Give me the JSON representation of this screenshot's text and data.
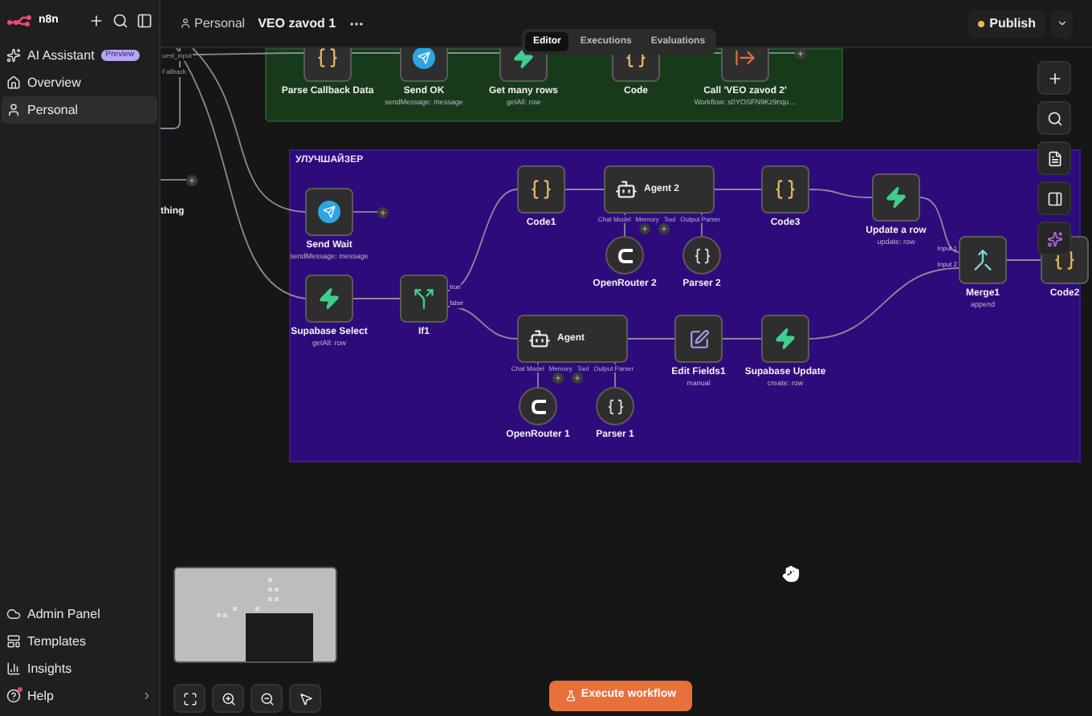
{
  "sidebar": {
    "logo": "n8n",
    "items": [
      {
        "label": "AI Assistant",
        "badge": "Preview",
        "selected": false
      },
      {
        "label": "Overview",
        "selected": false
      },
      {
        "label": "Personal",
        "selected": true
      }
    ],
    "bottom_items": [
      {
        "label": "Admin Panel",
        "notification": false
      },
      {
        "label": "Templates",
        "notification": false
      },
      {
        "label": "Insights",
        "notification": false
      },
      {
        "label": "Help",
        "notification": true
      }
    ]
  },
  "header": {
    "breadcrumb": "Personal",
    "title": "VEO zavod 1",
    "publish": "Publish"
  },
  "tabs": [
    {
      "label": "Editor",
      "selected": true
    },
    {
      "label": "Executions",
      "selected": false
    },
    {
      "label": "Evaluations",
      "selected": false
    }
  ],
  "canvas": {
    "edge_labels": [
      "uest_input",
      "Fallback",
      "thing"
    ],
    "green_group": {
      "nodes": [
        {
          "name": "Parse Callback Data",
          "kind": "code"
        },
        {
          "name": "Send OK",
          "subtitle": "sendMessage: message",
          "kind": "telegram"
        },
        {
          "name": "Get many rows",
          "subtitle": "getAll: row",
          "kind": "supabase"
        },
        {
          "name": "Code",
          "kind": "code"
        },
        {
          "name": "Call 'VEO zavod 2'",
          "subtitle": "Workflow: s0YOSFN9Kz9nqu…",
          "kind": "workflow"
        }
      ]
    },
    "purple_group": {
      "title": "УЛУЧШАЙЗЕР",
      "nodes": [
        {
          "name": "Send Wait",
          "subtitle": "sendMessage: message",
          "kind": "telegram"
        },
        {
          "name": "Supabase Select",
          "subtitle": "getAll: row",
          "kind": "supabase"
        },
        {
          "name": "If1",
          "kind": "if",
          "outputs": [
            "true",
            "false"
          ]
        },
        {
          "name": "Code1",
          "kind": "code"
        },
        {
          "name": "Agent 2",
          "kind": "agent",
          "ports": [
            "Chat Model",
            "Memory",
            "Tool",
            "Output Parser"
          ]
        },
        {
          "name": "OpenRouter 2",
          "kind": "model"
        },
        {
          "name": "Parser 2",
          "kind": "parser"
        },
        {
          "name": "Code3",
          "kind": "code"
        },
        {
          "name": "Update a row",
          "subtitle": "update: row",
          "kind": "supabase"
        },
        {
          "name": "Merge1",
          "subtitle": "append",
          "kind": "merge",
          "inputs": [
            "Input 1",
            "Input 2"
          ]
        },
        {
          "name": "Code2",
          "kind": "code"
        },
        {
          "name": "Agent",
          "kind": "agent",
          "ports": [
            "Chat Model",
            "Memory",
            "Tool",
            "Output Parser"
          ]
        },
        {
          "name": "OpenRouter 1",
          "kind": "model"
        },
        {
          "name": "Parser 1",
          "kind": "parser"
        },
        {
          "name": "Edit Fields1",
          "subtitle": "manual",
          "kind": "edit"
        },
        {
          "name": "Supabase Update",
          "subtitle": "create: row",
          "kind": "supabase"
        }
      ]
    }
  },
  "execute_button": "Execute workflow"
}
